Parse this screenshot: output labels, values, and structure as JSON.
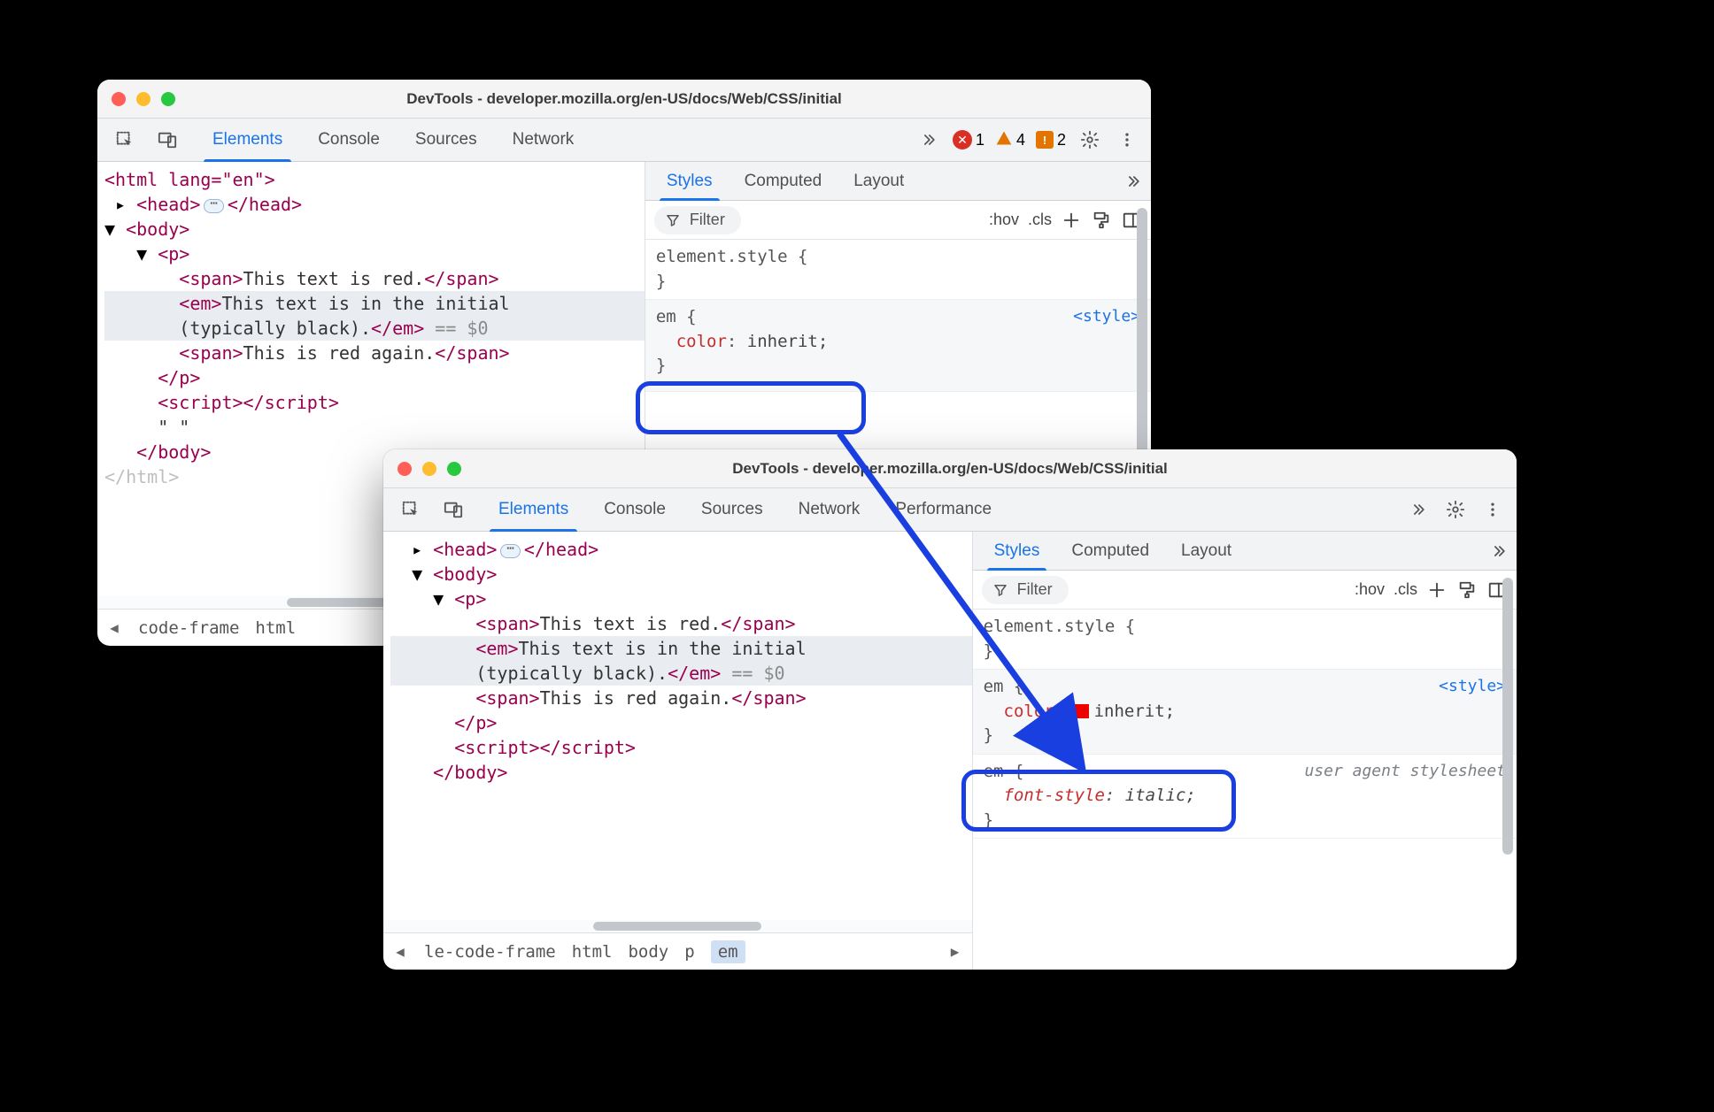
{
  "window_a": {
    "title": "DevTools - developer.mozilla.org/en-US/docs/Web/CSS/initial",
    "tabs": [
      "Elements",
      "Console",
      "Sources",
      "Network"
    ],
    "active_tab": "Elements",
    "status": {
      "errors": "1",
      "warnings": "4",
      "issues": "2"
    },
    "dom": {
      "l1": "<html lang=\"en\">",
      "l2a": "<head>",
      "l2b": "</head>",
      "l3": "<body>",
      "l4": "<p>",
      "l5a": "<span>",
      "l5t": "This text is red.",
      "l5b": "</span>",
      "l6a": "<em>",
      "l6t1": "This text is in the initial",
      "l6t2": "(typically black).",
      "l6b": "</em>",
      "l6c": " == $0",
      "l7a": "<span>",
      "l7t": "This is red again.",
      "l7b": "</span>",
      "l8": "</p>",
      "l9a": "<script>",
      "l9b": "</script>",
      "l10": "\" \"",
      "l11": "</body>",
      "l12": "</html>"
    },
    "crumbs": [
      "code-frame",
      "html"
    ],
    "styles": {
      "sub_tabs": [
        "Styles",
        "Computed",
        "Layout"
      ],
      "active_sub": "Styles",
      "filter": "Filter",
      "hov": ":hov",
      "cls": ".cls",
      "r1_sel": "element.style {",
      "r1_close": "}",
      "r2_sel": "em {",
      "r2_src": "<style>",
      "r2_prop": "color",
      "r2_val": "inherit;",
      "r2_close": "}"
    }
  },
  "window_b": {
    "title": "DevTools - developer.mozilla.org/en-US/docs/Web/CSS/initial",
    "tabs": [
      "Elements",
      "Console",
      "Sources",
      "Network",
      "Performance"
    ],
    "active_tab": "Elements",
    "dom": {
      "l2a": "<head>",
      "l2b": "</head>",
      "l3": "<body>",
      "l4": "<p>",
      "l5a": "<span>",
      "l5t": "This text is red.",
      "l5b": "</span>",
      "l6a": "<em>",
      "l6t1": "This text is in the initial",
      "l6t2": "(typically black).",
      "l6b": "</em>",
      "l6c": " == $0",
      "l7a": "<span>",
      "l7t": "This is red again.",
      "l7b": "</span>",
      "l8": "</p>",
      "l9a": "<script>",
      "l9b": "</script>",
      "l11": "</body>"
    },
    "crumbs": [
      "le-code-frame",
      "html",
      "body",
      "p",
      "em"
    ],
    "styles": {
      "sub_tabs": [
        "Styles",
        "Computed",
        "Layout"
      ],
      "active_sub": "Styles",
      "filter": "Filter",
      "hov": ":hov",
      "cls": ".cls",
      "r1_sel": "element.style {",
      "r1_close": "}",
      "r2_sel": "em {",
      "r2_src": "<style>",
      "r2_prop": "color",
      "r2_val": "inherit;",
      "r2_close": "}",
      "r3_sel": "em {",
      "r3_ua": "user agent stylesheet",
      "r3_prop": "font-style",
      "r3_val": "italic;",
      "r3_close": "}"
    }
  }
}
